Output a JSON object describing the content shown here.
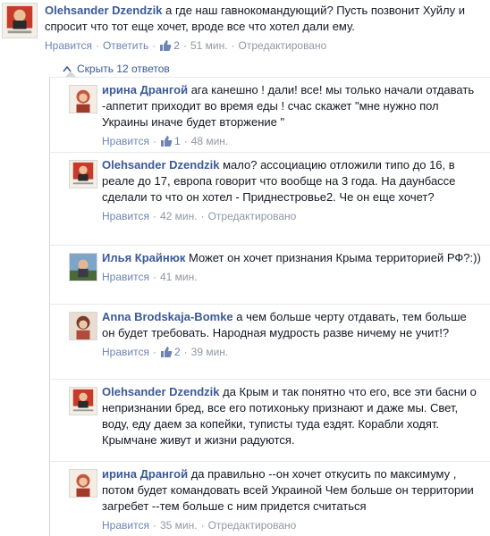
{
  "top_comment": {
    "author": "Olehsander Dzendzik",
    "text": "а где наш гавнокомандующий? Пусть позвонит Хуйлу и спросит что тот еще хочет, вроде все что хотел дали ему.",
    "like_label": "Нравится",
    "reply_label": "Ответить",
    "likes": "2",
    "time": "51 мин.",
    "edited": "Отредактировано"
  },
  "hide_replies": {
    "label": "Скрыть 12 ответов",
    "icon": "collapse-arrow-icon"
  },
  "replies": [
    {
      "author": "ирина Дрангой",
      "text": "ага канешно ! дали! все! мы только начали отдавать -аппетит приходит во время еды ! счас скажет \"мне нужно пол Украины иначе будет вторжение \"",
      "like_label": "Нравится",
      "likes": "1",
      "time": "48 мин.",
      "edited": ""
    },
    {
      "author": "Olehsander Dzendzik",
      "text": "мало? ассоциацию отложили типо до 16, в реале до 17, европа говорит что вообще на 3 года. На даунбассе сделали то что он хотел - Приднестровье2. Че он еще хочет?",
      "like_label": "Нравится",
      "likes": "",
      "time": "42 мин.",
      "edited": "Отредактировано"
    },
    {
      "author": "Илья Крайнюк",
      "text": "Может он хочет признания Крыма территорией РФ?:))",
      "like_label": "Нравится",
      "likes": "",
      "time": "41 мин.",
      "edited": ""
    },
    {
      "author": "Anna Brodskaja-Bomke",
      "text": "а чем больше черту отдавать, тем больше он будет требовать. Народная мудрость разве ничему не учит!?",
      "like_label": "Нравится",
      "likes": "2",
      "time": "39 мин.",
      "edited": ""
    },
    {
      "author": "Olehsander Dzendzik",
      "text": "да Крым и так понятно что его, все эти басни о непризнании бред, все его потихоньку признают и даже мы. Свет, воду, еду даем за копейки, туписты туда ездят. Корабли ходят. Крымчане живут и жизни радуются.",
      "like_label": "Нравится",
      "likes": "",
      "time": "",
      "edited": ""
    },
    {
      "author": "ирина Дрангой",
      "text": "да правильно --он хочет откусить по максимуму , потом будет командовать всей Украиной Чем больше он территории загребет --тем больше с ним придется считаться",
      "like_label": "Нравится",
      "likes": "",
      "time": "35 мин.",
      "edited": "Отредактировано"
    }
  ],
  "colors": {
    "author": "#3b5998",
    "link": "#6d84b4",
    "meta": "#9197a3",
    "text": "#141823",
    "divider": "#e9eaed"
  }
}
